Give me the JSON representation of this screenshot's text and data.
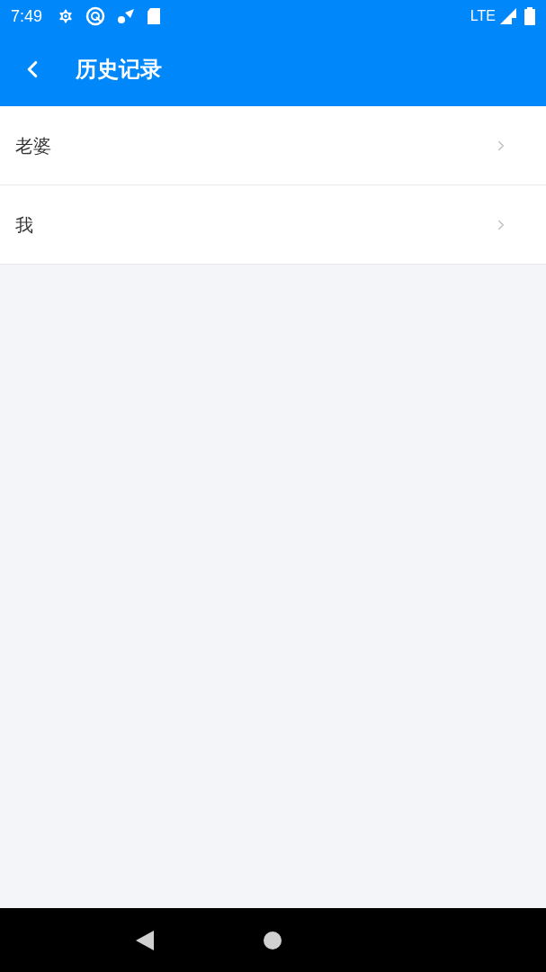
{
  "status_bar": {
    "time": "7:49",
    "network": "LTE"
  },
  "header": {
    "title": "历史记录"
  },
  "list": [
    {
      "label": "老婆"
    },
    {
      "label": "我"
    }
  ]
}
